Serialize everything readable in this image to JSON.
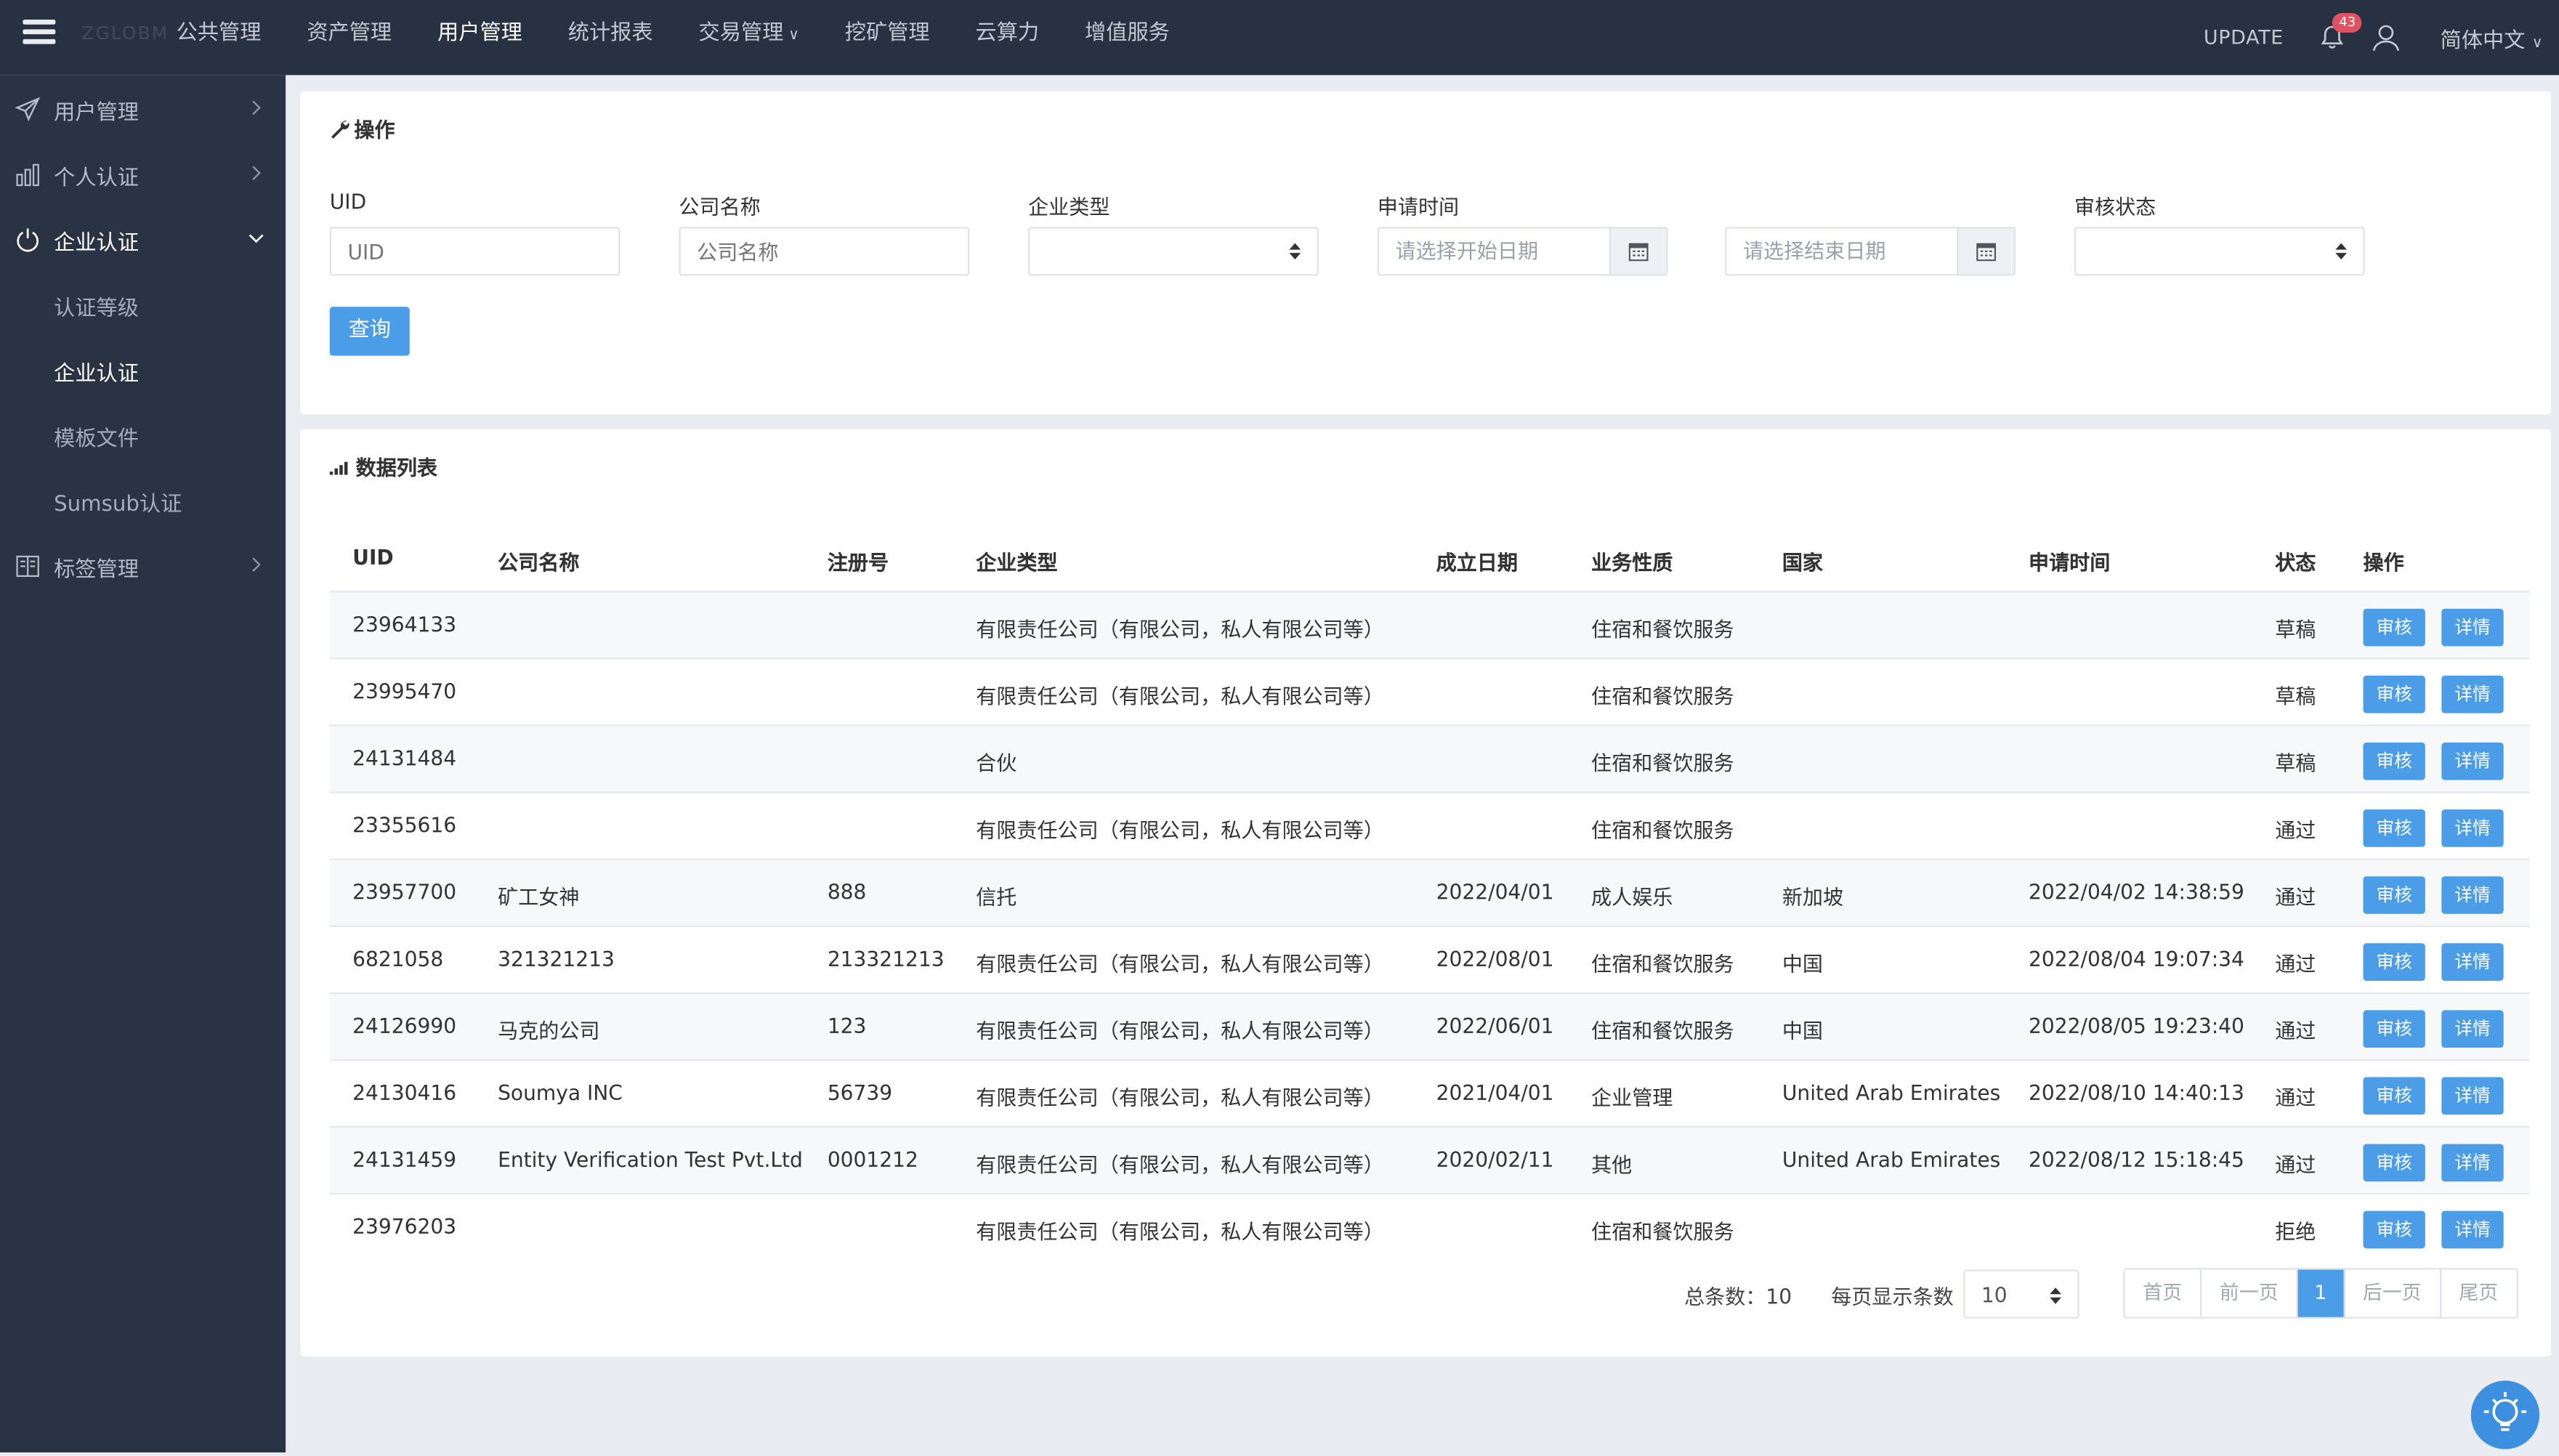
{
  "topbar": {
    "logo": "ZGLOBM",
    "nav": [
      "公共管理",
      "资产管理",
      "用户管理",
      "统计报表",
      "交易管理",
      "挖矿管理",
      "云算力",
      "增值服务"
    ],
    "update": "UPDATE",
    "notifications": "43",
    "language": "简体中文"
  },
  "sidebar": {
    "user_mgmt": "用户管理",
    "personal_auth": "个人认证",
    "enterprise_auth": "企业认证",
    "sub_level": "认证等级",
    "sub_enterprise": "企业认证",
    "sub_template": "模板文件",
    "sub_sumsub": "Sumsub认证",
    "tag_mgmt": "标签管理"
  },
  "filter": {
    "title": "操作",
    "uid_label": "UID",
    "uid_placeholder": "UID",
    "company_label": "公司名称",
    "company_placeholder": "公司名称",
    "type_label": "企业类型",
    "time_label": "申请时间",
    "start_placeholder": "请选择开始日期",
    "end_placeholder": "请选择结束日期",
    "status_label": "审核状态",
    "query": "查询"
  },
  "list": {
    "title": "数据列表",
    "headers": [
      "UID",
      "公司名称",
      "注册号",
      "企业类型",
      "成立日期",
      "业务性质",
      "国家",
      "申请时间",
      "状态",
      "操作"
    ],
    "btn_review": "审核",
    "btn_detail": "详情",
    "rows": [
      [
        "23964133",
        "",
        "",
        "有限责任公司（有限公司，私人有限公司等）",
        "",
        "住宿和餐饮服务",
        "",
        "",
        "草稿"
      ],
      [
        "23995470",
        "",
        "",
        "有限责任公司（有限公司，私人有限公司等）",
        "",
        "住宿和餐饮服务",
        "",
        "",
        "草稿"
      ],
      [
        "24131484",
        "",
        "",
        "合伙",
        "",
        "住宿和餐饮服务",
        "",
        "",
        "草稿"
      ],
      [
        "23355616",
        "",
        "",
        "有限责任公司（有限公司，私人有限公司等）",
        "",
        "住宿和餐饮服务",
        "",
        "",
        "通过"
      ],
      [
        "23957700",
        "矿工女神",
        "888",
        "信托",
        "2022/04/01",
        "成人娱乐",
        "新加坡",
        "2022/04/02 14:38:59",
        "通过"
      ],
      [
        "6821058",
        "321321213",
        "213321213",
        "有限责任公司（有限公司，私人有限公司等）",
        "2022/08/01",
        "住宿和餐饮服务",
        "中国",
        "2022/08/04 19:07:34",
        "通过"
      ],
      [
        "24126990",
        "马克的公司",
        "123",
        "有限责任公司（有限公司，私人有限公司等）",
        "2022/06/01",
        "住宿和餐饮服务",
        "中国",
        "2022/08/05 19:23:40",
        "通过"
      ],
      [
        "24130416",
        "Soumya INC",
        "56739",
        "有限责任公司（有限公司，私人有限公司等）",
        "2021/04/01",
        "企业管理",
        "United Arab Emirates",
        "2022/08/10 14:40:13",
        "通过"
      ],
      [
        "24131459",
        "Entity Verification Test Pvt.Ltd",
        "0001212",
        "有限责任公司（有限公司，私人有限公司等）",
        "2020/02/11",
        "其他",
        "United Arab Emirates",
        "2022/08/12 15:18:45",
        "通过"
      ],
      [
        "23976203",
        "",
        "",
        "有限责任公司（有限公司，私人有限公司等）",
        "",
        "住宿和餐饮服务",
        "",
        "",
        "拒绝"
      ]
    ]
  },
  "pagination": {
    "total_label": "总条数：10",
    "per_page_label": "每页显示条数",
    "per_page_value": "10",
    "first": "首页",
    "prev": "前一页",
    "current": "1",
    "next": "后一页",
    "last": "尾页"
  }
}
